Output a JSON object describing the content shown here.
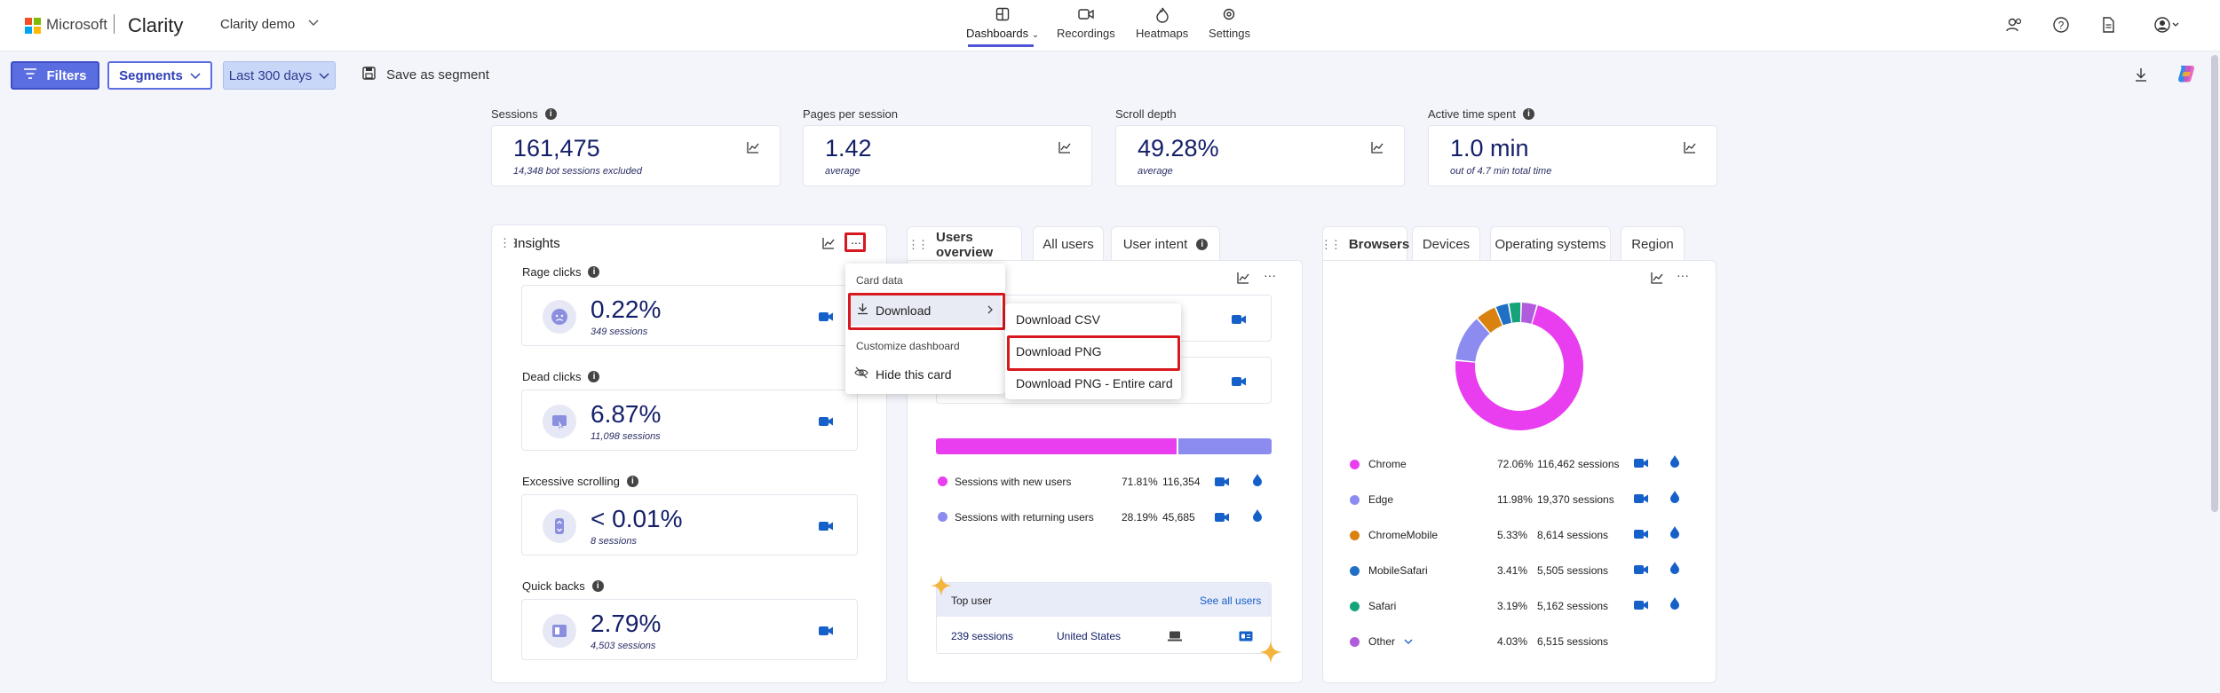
{
  "header": {
    "brand": "Microsoft",
    "product": "Clarity",
    "project": "Clarity demo",
    "nav": [
      {
        "label": "Dashboards",
        "icon": "dashboard-icon",
        "active": true
      },
      {
        "label": "Recordings",
        "icon": "video-icon",
        "active": false
      },
      {
        "label": "Heatmaps",
        "icon": "flame-icon",
        "active": false
      },
      {
        "label": "Settings",
        "icon": "gear-icon",
        "active": false
      }
    ],
    "right_icons": [
      "share-user-icon",
      "help-icon",
      "document-icon",
      "account-icon"
    ]
  },
  "toolbar": {
    "filters_label": "Filters",
    "segments_label": "Segments",
    "range_label": "Last 300 days",
    "save_label": "Save as segment"
  },
  "kpis": [
    {
      "label": "Sessions",
      "value": "161,475",
      "sub": "14,348 bot sessions excluded",
      "has_info": true
    },
    {
      "label": "Pages per session",
      "value": "1.42",
      "sub": "average",
      "has_info": false
    },
    {
      "label": "Scroll depth",
      "value": "49.28%",
      "sub": "average",
      "has_info": false
    },
    {
      "label": "Active time spent",
      "value": "1.0 min",
      "sub": "out of 4.7 min total time",
      "has_info": true
    }
  ],
  "insights": {
    "title": "Insights",
    "more": "...",
    "items": [
      {
        "label": "Rage clicks",
        "value": "0.22%",
        "sub": "349 sessions"
      },
      {
        "label": "Dead clicks",
        "value": "6.87%",
        "sub": "11,098 sessions"
      },
      {
        "label": "Excessive scrolling",
        "value": "< 0.01%",
        "sub": "8 sessions"
      },
      {
        "label": "Quick backs",
        "value": "2.79%",
        "sub": "4,503 sessions"
      }
    ]
  },
  "card_menu": {
    "header1": "Card data",
    "download": "Download",
    "header2": "Customize dashboard",
    "hide": "Hide this card"
  },
  "download_menu": {
    "csv": "Download CSV",
    "png": "Download PNG",
    "png_entire": "Download PNG - Entire card"
  },
  "users": {
    "tabs": [
      "Users overview",
      "All users",
      "User intent"
    ],
    "new_fraction": 0.7181,
    "rows": [
      {
        "label": "Sessions with new users",
        "pct": "71.81%",
        "count": "116,354",
        "color": "#e83ef0"
      },
      {
        "label": "Sessions with returning users",
        "pct": "28.19%",
        "count": "45,685",
        "color": "#8c8cf0"
      }
    ],
    "top_user": {
      "title": "Top user",
      "link": "See all users",
      "sessions": "239 sessions",
      "country": "United States"
    }
  },
  "browsers": {
    "tabs": [
      "Browsers",
      "Devices",
      "Operating systems",
      "Region"
    ],
    "rows": [
      {
        "name": "Chrome",
        "pct": "72.06%",
        "sessions": "116,462 sessions",
        "color": "#e83ef0",
        "fraction": 0.7206
      },
      {
        "name": "Edge",
        "pct": "11.98%",
        "sessions": "19,370 sessions",
        "color": "#8c8cf0",
        "fraction": 0.1198
      },
      {
        "name": "ChromeMobile",
        "pct": "5.33%",
        "sessions": "8,614 sessions",
        "color": "#d9820f",
        "fraction": 0.0533
      },
      {
        "name": "MobileSafari",
        "pct": "3.41%",
        "sessions": "5,505 sessions",
        "color": "#1f6fc4",
        "fraction": 0.0341
      },
      {
        "name": "Safari",
        "pct": "3.19%",
        "sessions": "5,162 sessions",
        "color": "#16a37a",
        "fraction": 0.0319
      },
      {
        "name": "Other",
        "pct": "4.03%",
        "sessions": "6,515 sessions",
        "color": "#b05cdc",
        "fraction": 0.0403
      }
    ]
  }
}
